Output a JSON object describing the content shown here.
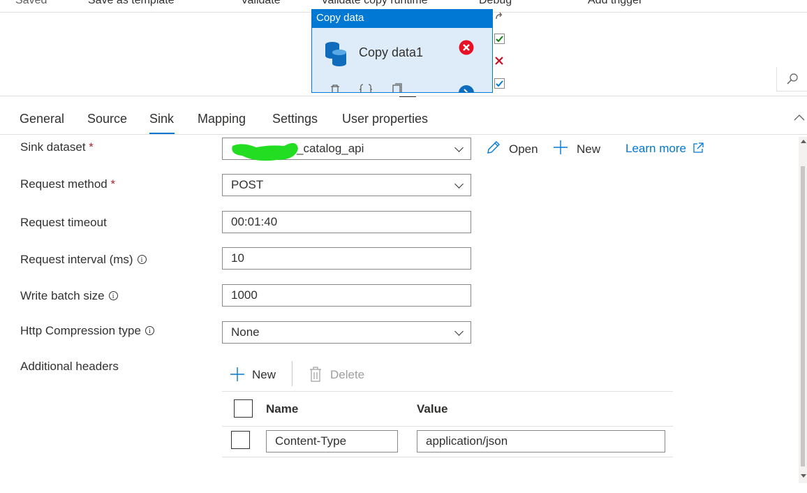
{
  "toolbar": {
    "saved": "Saved",
    "save_as_template": "Save as template",
    "validate": "Validate",
    "validate_copy_runtime": "Validate copy runtime",
    "debug": "Debug",
    "add_trigger": "Add trigger"
  },
  "activity": {
    "type": "Copy data",
    "name": "Copy data1"
  },
  "tabs": [
    "General",
    "Source",
    "Sink",
    "Mapping",
    "Settings",
    "User properties"
  ],
  "active_tab": "Sink",
  "form": {
    "sink_dataset": {
      "label": "Sink dataset",
      "value": "_catalog_api"
    },
    "request_method": {
      "label": "Request method",
      "value": "POST"
    },
    "request_timeout": {
      "label": "Request timeout",
      "value": "00:01:40"
    },
    "request_interval": {
      "label": "Request interval (ms)",
      "value": "10"
    },
    "write_batch_size": {
      "label": "Write batch size",
      "value": "1000"
    },
    "http_compression": {
      "label": "Http Compression type",
      "value": "None"
    },
    "additional_headers": {
      "label": "Additional headers"
    }
  },
  "required_mark": "*",
  "info_glyph": "i",
  "actions": {
    "open": "Open",
    "new": "New",
    "learn_more": "Learn more"
  },
  "headers": {
    "new": "New",
    "delete": "Delete",
    "columns": {
      "name": "Name",
      "value": "Value"
    },
    "rows": [
      {
        "name": "Content-Type",
        "value": "application/json"
      }
    ]
  },
  "colors": {
    "accent": "#0078d4",
    "error": "#e81123",
    "success": "#107c10",
    "redaction": "#22dd22"
  },
  "icons": [
    "database-icon",
    "error-icon",
    "delete-icon",
    "code-icon",
    "copy-icon",
    "arrow-icon",
    "search-icon",
    "collapse-icon",
    "pencil-icon",
    "plus-icon",
    "external-link-icon",
    "trash-icon",
    "check-icon",
    "x-icon",
    "redo-icon"
  ]
}
